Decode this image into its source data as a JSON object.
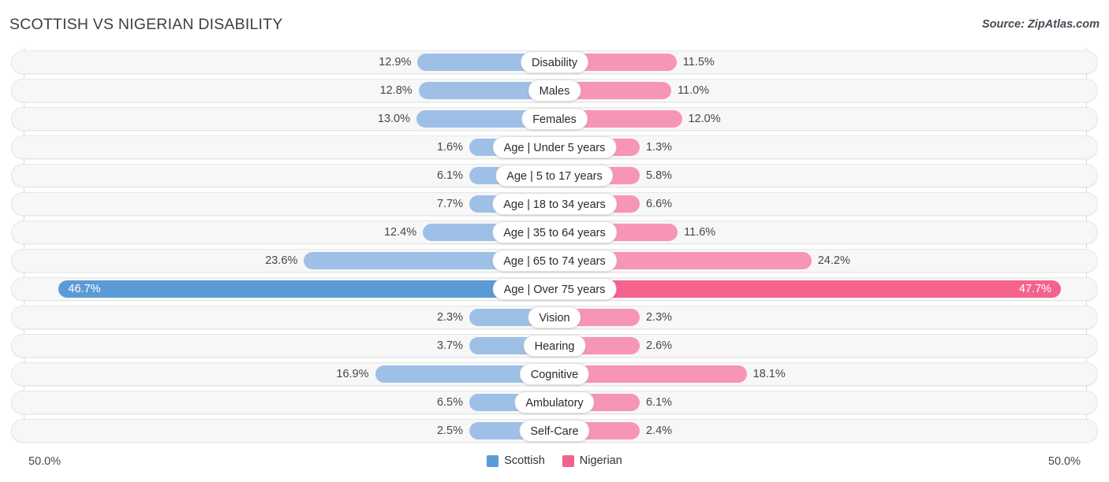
{
  "header": {
    "title": "SCOTTISH VS NIGERIAN DISABILITY",
    "source": "Source: ZipAtlas.com"
  },
  "axis": {
    "left_label": "50.0%",
    "right_label": "50.0%",
    "max": 50.0
  },
  "legend": {
    "items": [
      {
        "label": "Scottish",
        "color": "#5b9bd5",
        "icon": "square-swatch"
      },
      {
        "label": "Nigerian",
        "color": "#f4628e",
        "icon": "square-swatch"
      }
    ]
  },
  "colors": {
    "scottish_bar": "#9fc0e6",
    "nigerian_bar": "#f795b4",
    "scottish_bar_highlight": "#5b9bd5",
    "nigerian_bar_highlight": "#f4628e",
    "track": "#f7f7f7",
    "gridline": "#d8d8d8"
  },
  "chart_data": {
    "type": "bar",
    "subtype": "diverging-bidirectional",
    "title": "SCOTTISH VS NIGERIAN DISABILITY",
    "xlabel": "",
    "ylabel": "",
    "xlim": [
      -50.0,
      50.0
    ],
    "axis_tick_labels": [
      "50.0%",
      "50.0%"
    ],
    "grid": true,
    "legend_position": "bottom-center",
    "categories": [
      "Disability",
      "Males",
      "Females",
      "Age | Under 5 years",
      "Age | 5 to 17 years",
      "Age | 18 to 34 years",
      "Age | 35 to 64 years",
      "Age | 65 to 74 years",
      "Age | Over 75 years",
      "Vision",
      "Hearing",
      "Cognitive",
      "Ambulatory",
      "Self-Care"
    ],
    "series": [
      {
        "name": "Scottish",
        "color": "#9fc0e6",
        "side": "left",
        "values": [
          12.9,
          12.8,
          13.0,
          1.6,
          6.1,
          7.7,
          12.4,
          23.6,
          46.7,
          2.3,
          3.7,
          16.9,
          6.5,
          2.5
        ],
        "labels": [
          "12.9%",
          "12.8%",
          "13.0%",
          "1.6%",
          "6.1%",
          "7.7%",
          "12.4%",
          "23.6%",
          "46.7%",
          "2.3%",
          "3.7%",
          "16.9%",
          "6.5%",
          "2.5%"
        ]
      },
      {
        "name": "Nigerian",
        "color": "#f795b4",
        "side": "right",
        "values": [
          11.5,
          11.0,
          12.0,
          1.3,
          5.8,
          6.6,
          11.6,
          24.2,
          47.7,
          2.3,
          2.6,
          18.1,
          6.1,
          2.4
        ],
        "labels": [
          "11.5%",
          "11.0%",
          "12.0%",
          "1.3%",
          "5.8%",
          "6.6%",
          "11.6%",
          "24.2%",
          "47.7%",
          "2.3%",
          "2.6%",
          "18.1%",
          "6.1%",
          "2.4%"
        ]
      }
    ],
    "highlighted_row_index": 8
  }
}
